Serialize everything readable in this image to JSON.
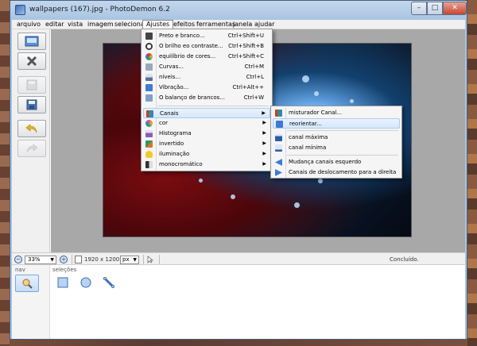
{
  "window": {
    "title": "wallpapers (167).jpg  -  PhotoDemon 6.2",
    "minimize_glyph": "–",
    "maximize_glyph": "□",
    "close_glyph": "✕"
  },
  "menubar": {
    "items": [
      {
        "label": "arquivo"
      },
      {
        "label": "editar"
      },
      {
        "label": "vista"
      },
      {
        "label": "imagem"
      },
      {
        "label": "selecionar"
      },
      {
        "label": "Ajustes",
        "active": true
      },
      {
        "label": "efeitos"
      },
      {
        "label": "ferramentas"
      },
      {
        "label": "janela"
      },
      {
        "label": "ajudar"
      }
    ]
  },
  "left_toolbar": {
    "buttons": [
      {
        "icon": "open-image-icon",
        "enabled": true
      },
      {
        "icon": "close-image-icon",
        "enabled": true
      },
      {
        "icon": "save-disabled-icon",
        "enabled": false
      },
      {
        "icon": "save-as-icon",
        "enabled": true
      },
      {
        "icon": "undo-icon",
        "enabled": true
      },
      {
        "icon": "redo-icon",
        "enabled": false
      }
    ]
  },
  "ajustes_menu": {
    "items": [
      {
        "label": "Preto e branco...",
        "shortcut": "Ctrl+Shift+U",
        "icon": "black-white-icon",
        "color": "#444444"
      },
      {
        "label": "O brilho eo contraste...",
        "shortcut": "Ctrl+Shift+B",
        "icon": "brightness-icon",
        "color": "#333333"
      },
      {
        "label": "equilíbrio de cores...",
        "shortcut": "Ctrl+Shift+C",
        "icon": "color-balance-icon",
        "color": "#d9332a"
      },
      {
        "label": "Curvas...",
        "shortcut": "Ctrl+M",
        "icon": "curves-icon",
        "color": "#9aa9b8"
      },
      {
        "label": "níveis...",
        "shortcut": "Ctrl+L",
        "icon": "levels-icon",
        "color": "#5b6f9a"
      },
      {
        "label": "Vibração...",
        "shortcut": "Ctrl+Alt++",
        "icon": "vibrance-icon",
        "color": "#3f7ad6"
      },
      {
        "label": "O balanço de brancos...",
        "shortcut": "Ctrl+W",
        "icon": "white-balance-icon",
        "color": "#7ea0c8"
      },
      {
        "label": "Canais",
        "submenu": true,
        "hover": true,
        "icon": "channels-icon",
        "color": "#e0712a"
      },
      {
        "label": "cor",
        "submenu": true,
        "icon": "color-icon",
        "color": "#e64b9a"
      },
      {
        "label": "Histograma",
        "submenu": true,
        "icon": "histogram-icon",
        "color": "#8a5bb8"
      },
      {
        "label": "invertido",
        "submenu": true,
        "icon": "invert-icon",
        "color": "#2a9b6a"
      },
      {
        "label": "iluminação",
        "submenu": true,
        "icon": "lighting-icon",
        "color": "#f2c92a"
      },
      {
        "label": "monocromático",
        "submenu": true,
        "icon": "monochrome-icon",
        "color": "#333333"
      }
    ]
  },
  "canais_submenu": {
    "items": [
      {
        "label": "misturador Canal...",
        "icon": "channel-mixer-icon",
        "color": "#e0712a"
      },
      {
        "label": "reorientar...",
        "icon": "rechannel-icon",
        "color": "#3f7ad6",
        "hover": true
      },
      {
        "label": "canal máxima",
        "icon": "max-channel-icon",
        "color": "#2a5caa"
      },
      {
        "label": "canal mínima",
        "icon": "min-channel-icon",
        "color": "#2a5caa"
      },
      {
        "label": "Mudança canais esquerdo",
        "icon": "shift-left-icon",
        "color": "#3f7ad6"
      },
      {
        "label": "Canais de deslocamento para a direita",
        "icon": "shift-right-icon",
        "color": "#3f7ad6"
      }
    ]
  },
  "status_bar": {
    "zoom_out_glyph": "−",
    "zoom_in_glyph": "+",
    "zoom_value": "33%",
    "image_size": "1920 x 1200",
    "unit_value": "px",
    "status_message": "Concluído."
  },
  "bottom_panel": {
    "nav_label": "nav",
    "selections_label": "seleções"
  },
  "colors": {
    "menu_hover": "#d6e8fb",
    "title_bg": "#a9c4e0",
    "close_button": "#c9462f"
  }
}
